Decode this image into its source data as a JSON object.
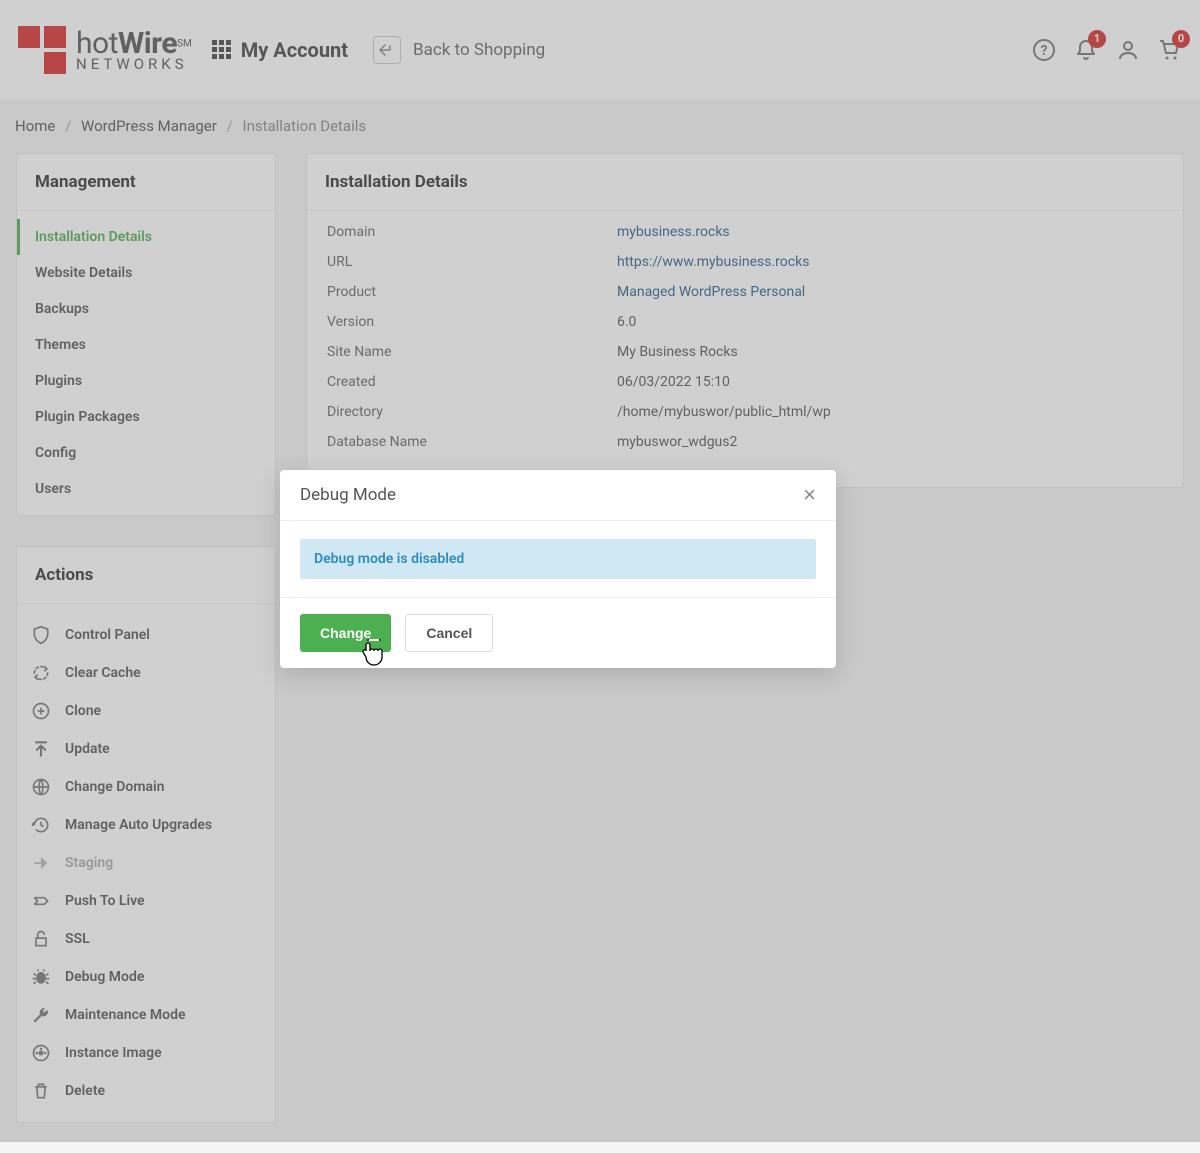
{
  "header": {
    "logo_main": "hotWire",
    "logo_sub": "NETWORKS",
    "logo_sm": "SM",
    "my_account_label": "My Account",
    "back_label": "Back to Shopping",
    "notif_count": "1",
    "cart_count": "0"
  },
  "breadcrumb": [
    {
      "label": "Home",
      "link": true
    },
    {
      "label": "WordPress Manager",
      "link": true
    },
    {
      "label": "Installation Details",
      "link": false
    }
  ],
  "sidebar": {
    "management_title": "Management",
    "management_items": [
      {
        "label": "Installation Details",
        "active": true
      },
      {
        "label": "Website Details",
        "active": false
      },
      {
        "label": "Backups",
        "active": false
      },
      {
        "label": "Themes",
        "active": false
      },
      {
        "label": "Plugins",
        "active": false
      },
      {
        "label": "Plugin Packages",
        "active": false
      },
      {
        "label": "Config",
        "active": false
      },
      {
        "label": "Users",
        "active": false
      }
    ],
    "actions_title": "Actions",
    "actions_items": [
      {
        "icon": "shield-icon",
        "label": "Control Panel"
      },
      {
        "icon": "refresh-icon",
        "label": "Clear Cache"
      },
      {
        "icon": "clone-icon",
        "label": "Clone"
      },
      {
        "icon": "upload-icon",
        "label": "Update"
      },
      {
        "icon": "globe-icon",
        "label": "Change Domain"
      },
      {
        "icon": "history-icon",
        "label": "Manage Auto Upgrades"
      },
      {
        "icon": "arrow-right-icon",
        "label": "Staging",
        "muted": true
      },
      {
        "icon": "push-icon",
        "label": "Push To Live"
      },
      {
        "icon": "lock-icon",
        "label": "SSL"
      },
      {
        "icon": "bug-icon",
        "label": "Debug Mode"
      },
      {
        "icon": "wrench-icon",
        "label": "Maintenance Mode"
      },
      {
        "icon": "disc-icon",
        "label": "Instance Image"
      },
      {
        "icon": "trash-icon",
        "label": "Delete"
      }
    ]
  },
  "main": {
    "title": "Installation Details",
    "rows": [
      {
        "label": "Domain",
        "value": "mybusiness.rocks",
        "link": true
      },
      {
        "label": "URL",
        "value": "https://www.mybusiness.rocks",
        "link": true
      },
      {
        "label": "Product",
        "value": "Managed WordPress Personal",
        "link": true
      },
      {
        "label": "Version",
        "value": "6.0",
        "link": false
      },
      {
        "label": "Site Name",
        "value": "My Business Rocks",
        "link": false
      },
      {
        "label": "Created",
        "value": "06/03/2022 15:10",
        "link": false
      },
      {
        "label": "Directory",
        "value": "/home/mybuswor/public_html/wp",
        "link": false
      },
      {
        "label": "Database Name",
        "value": "mybuswor_wdgus2",
        "link": false
      }
    ]
  },
  "modal": {
    "title": "Debug Mode",
    "message": "Debug mode is disabled",
    "change_label": "Change",
    "cancel_label": "Cancel"
  }
}
